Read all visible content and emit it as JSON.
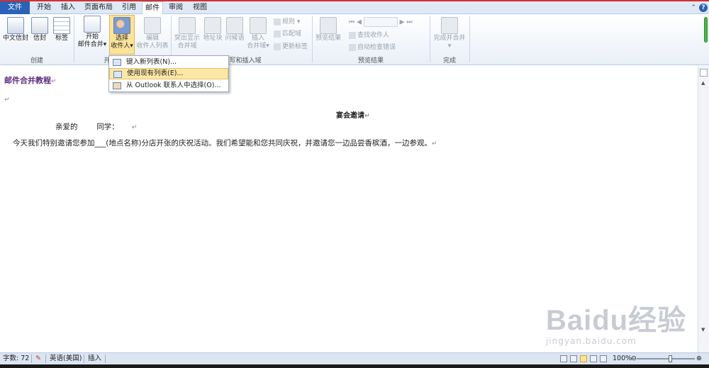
{
  "tabs": [
    "文件",
    "开始",
    "插入",
    "页面布局",
    "引用",
    "邮件",
    "审阅",
    "视图"
  ],
  "ribbon": {
    "create": {
      "label": "创建",
      "chinese_envelope": "中文信封",
      "envelope": "信封",
      "labels": "标签"
    },
    "start_merge": {
      "label_partial": "开",
      "start_line1": "开始",
      "start_line2": "邮件合并",
      "select_line1": "选择",
      "select_line2": "收件人",
      "edit_line1": "编辑",
      "edit_line2": "收件人列表"
    },
    "write_insert": {
      "label_partial": "写和插入域",
      "highlight_line1": "突出显示",
      "highlight_line2": "合并域",
      "address_block": "地址块",
      "greeting_line": "问候语",
      "insert_line1": "插入",
      "insert_line2": "合并域",
      "rules": "规则",
      "match_fields": "匹配域",
      "update_labels": "更新标签"
    },
    "preview": {
      "label": "预览结果",
      "preview_results": "预览结果",
      "find_recipient": "查找收件人",
      "auto_check": "自动检查错误"
    },
    "finish": {
      "label": "完成",
      "finish_merge_line1": "完成并合并"
    }
  },
  "dropdown": {
    "items": [
      "键入新列表(N)...",
      "使用现有列表(E)...",
      "从 Outlook 联系人中选择(O)..."
    ]
  },
  "document": {
    "heading": "邮件合并教程",
    "title": "宴会邀请",
    "greeting": "亲爱的        同学：",
    "body": "今天我们特别邀请您参加___(地点名称)分店开张的庆祝活动。我们希望能和您共同庆祝，并邀请您一边品尝香槟酒，一边参观。",
    "para_mark": "↵"
  },
  "status": {
    "word_count": "字数: 72",
    "language": "英语(美国)",
    "mode": "插入",
    "zoom": "100%"
  },
  "watermark": {
    "logo": "Baidu经验",
    "url": "jingyan.baidu.com"
  },
  "colors": {
    "accent": "#2a62b8",
    "heading": "#5b2c82",
    "highlight": "#fce7a6"
  }
}
